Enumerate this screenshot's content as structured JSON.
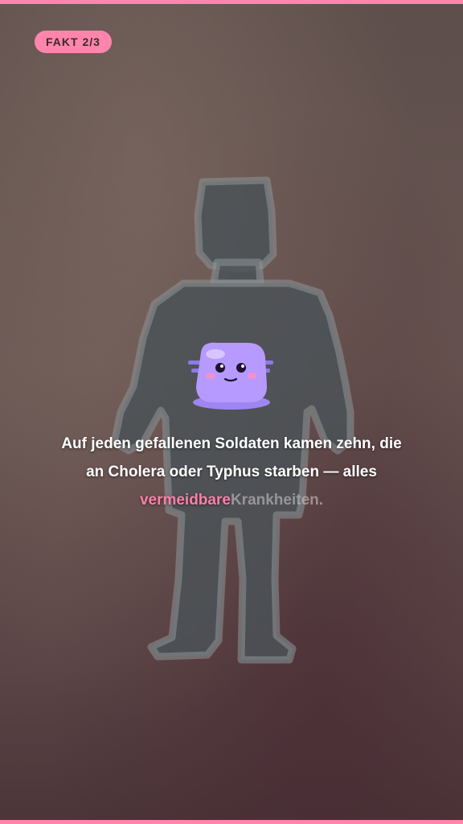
{
  "badge": {
    "label": "FAKT 2/3"
  },
  "caption": {
    "line1": "Auf jeden gefallenen Soldaten kamen zehn, die",
    "line2": "an Cholera oder Typhus starben — alles",
    "highlight": "vermeidbare",
    "faded": "Krankheiten."
  },
  "colors": {
    "accent": "#ff85ac",
    "highlight": "#ff7fa8",
    "mascot": "#b69aff",
    "silhouette": "#4b5257"
  },
  "icons": {
    "figure": "soldier-silhouette",
    "mascot": "blob-mascot"
  }
}
